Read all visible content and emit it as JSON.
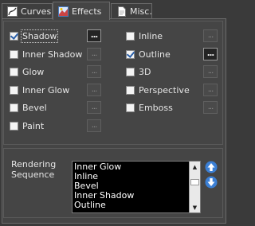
{
  "tabs": [
    {
      "label": "Curves",
      "icon": "curves-icon"
    },
    {
      "label": "Effects",
      "icon": "effects-icon",
      "active": true
    },
    {
      "label": "Misc.",
      "icon": "document-icon"
    }
  ],
  "effects": {
    "dots": "...",
    "left": [
      {
        "label": "Shadow",
        "checked": true
      },
      {
        "label": "Inner Shadow",
        "checked": false
      },
      {
        "label": "Glow",
        "checked": false
      },
      {
        "label": "Inner Glow",
        "checked": false
      },
      {
        "label": "Bevel",
        "checked": false
      },
      {
        "label": "Paint",
        "checked": false
      }
    ],
    "right": [
      {
        "label": "Inline",
        "checked": false
      },
      {
        "label": "Outline",
        "checked": true
      },
      {
        "label": "3D",
        "checked": false
      },
      {
        "label": "Perspective",
        "checked": false
      },
      {
        "label": "Emboss",
        "checked": false
      }
    ]
  },
  "rendering": {
    "label_line1": "Rendering",
    "label_line2": "Sequence",
    "items": [
      "Inner Glow",
      "Inline",
      "Bevel",
      "Inner Shadow",
      "Outline"
    ]
  },
  "colors": {
    "background": "#454545",
    "accent": "#4a90d9"
  }
}
